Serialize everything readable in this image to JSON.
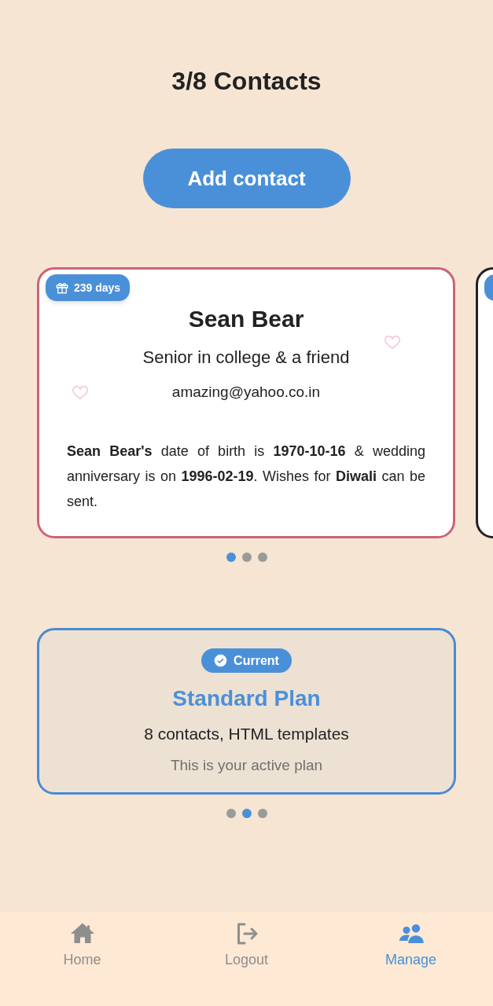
{
  "header": {
    "title": "3/8 Contacts"
  },
  "add_button": {
    "label": "Add contact"
  },
  "contacts_carousel": {
    "cards": [
      {
        "kind": "full",
        "badge": "239 days",
        "name": "Sean Bear",
        "relation": "Senior in college & a friend",
        "email": "amazing@yahoo.co.in",
        "description": "**Sean Bear's** date of birth is **1970-10-16** & wedding anniversary is on **1996-02-19**. Wishes for **Diwali** can be sent."
      },
      {
        "kind": "peek"
      }
    ],
    "dots": [
      {
        "selected": true
      },
      {
        "selected": false
      },
      {
        "selected": false
      }
    ]
  },
  "plan_carousel": {
    "card": {
      "badge": "Current",
      "title": "Standard Plan",
      "features": "8 contacts, HTML templates",
      "note": "This is your active plan"
    },
    "dots": [
      {
        "selected": false
      },
      {
        "selected": true
      },
      {
        "selected": false
      }
    ]
  },
  "bottom_nav": [
    {
      "kind": "home",
      "label": "Home",
      "selected": false
    },
    {
      "kind": "logout",
      "label": "Logout",
      "selected": false
    },
    {
      "kind": "manage",
      "label": "Manage",
      "selected": true
    }
  ]
}
